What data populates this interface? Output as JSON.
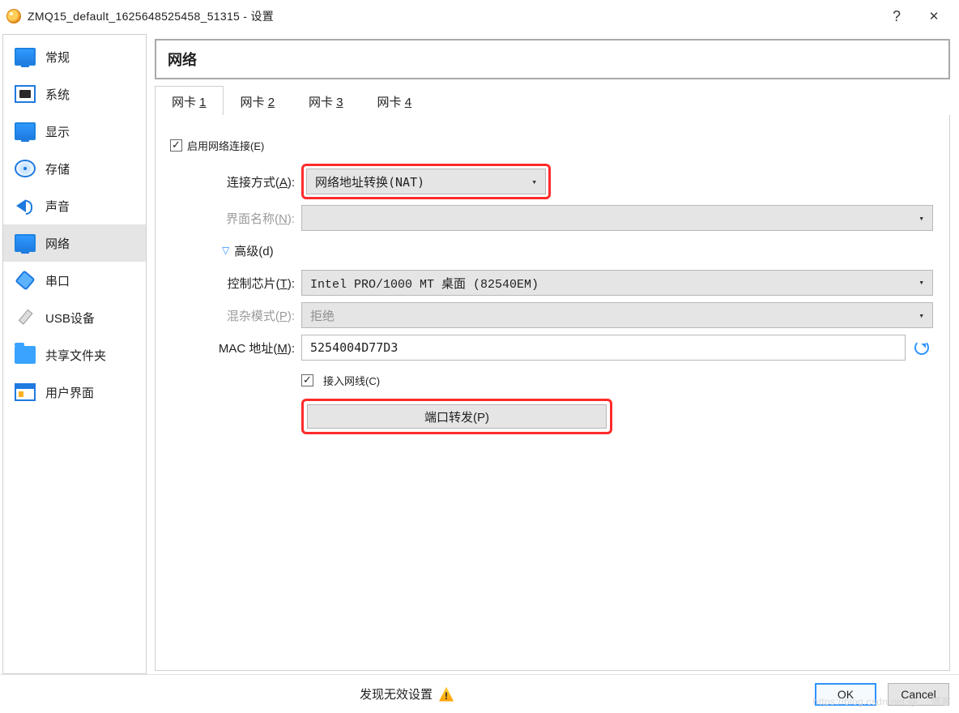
{
  "titlebar": {
    "app_icon": "virtualbox-icon",
    "title": "ZMQ15_default_1625648525458_51315 - 设置",
    "help_symbol": "?",
    "close_symbol": "✕"
  },
  "sidebar": {
    "items": [
      {
        "icon": "monitor-icon",
        "label": "常规"
      },
      {
        "icon": "chip-icon",
        "label": "系统"
      },
      {
        "icon": "monitor-icon",
        "label": "显示"
      },
      {
        "icon": "disk-icon",
        "label": "存储"
      },
      {
        "icon": "sound-icon",
        "label": "声音"
      },
      {
        "icon": "monitor-icon",
        "label": "网络",
        "selected": true
      },
      {
        "icon": "plug-icon",
        "label": "串口"
      },
      {
        "icon": "usb-icon",
        "label": "USB设备"
      },
      {
        "icon": "folder-icon",
        "label": "共享文件夹"
      },
      {
        "icon": "layout-icon",
        "label": "用户界面"
      }
    ]
  },
  "header": {
    "title": "网络"
  },
  "tabs": [
    {
      "prefix": "网卡 ",
      "hot": "1",
      "active": true
    },
    {
      "prefix": "网卡 ",
      "hot": "2"
    },
    {
      "prefix": "网卡 ",
      "hot": "3"
    },
    {
      "prefix": "网卡 ",
      "hot": "4"
    }
  ],
  "form": {
    "enable": {
      "checked": true,
      "label_pre": "启用网络连接(",
      "hot": "E",
      "label_post": ")"
    },
    "attached": {
      "label_pre": "连接方式(",
      "hot": "A",
      "label_post": "):",
      "value": "网络地址转换(NAT)",
      "highlighted": true
    },
    "iface": {
      "label_pre": "界面名称(",
      "hot": "N",
      "label_post": "):",
      "value": "",
      "disabled": true
    },
    "advanced": {
      "tri": "▽",
      "label_pre": "高级(",
      "hot": "d",
      "label_post": ")"
    },
    "chip": {
      "label_pre": "控制芯片(",
      "hot": "T",
      "label_post": "):",
      "value": "Intel PRO/1000 MT 桌面 (82540EM)"
    },
    "promisc": {
      "label_pre": "混杂模式(",
      "hot": "P",
      "label_post": "):",
      "value": "拒绝",
      "disabled": true
    },
    "mac": {
      "label_pre": "MAC 地址(",
      "hot": "M",
      "label_post": "):",
      "value": "5254004D77D3"
    },
    "cable": {
      "checked": true,
      "label_pre": "接入网线(",
      "hot": "C",
      "label_post": ")"
    },
    "portfwd": {
      "label_pre": "端口转发(",
      "hot": "P",
      "label_post": ")",
      "highlighted": true
    }
  },
  "footer": {
    "invalid_label": "发现无效设置",
    "ok": "OK",
    "cancel": "Cancel"
  },
  "watermark": "https://blog.csdn.net @… 博客"
}
